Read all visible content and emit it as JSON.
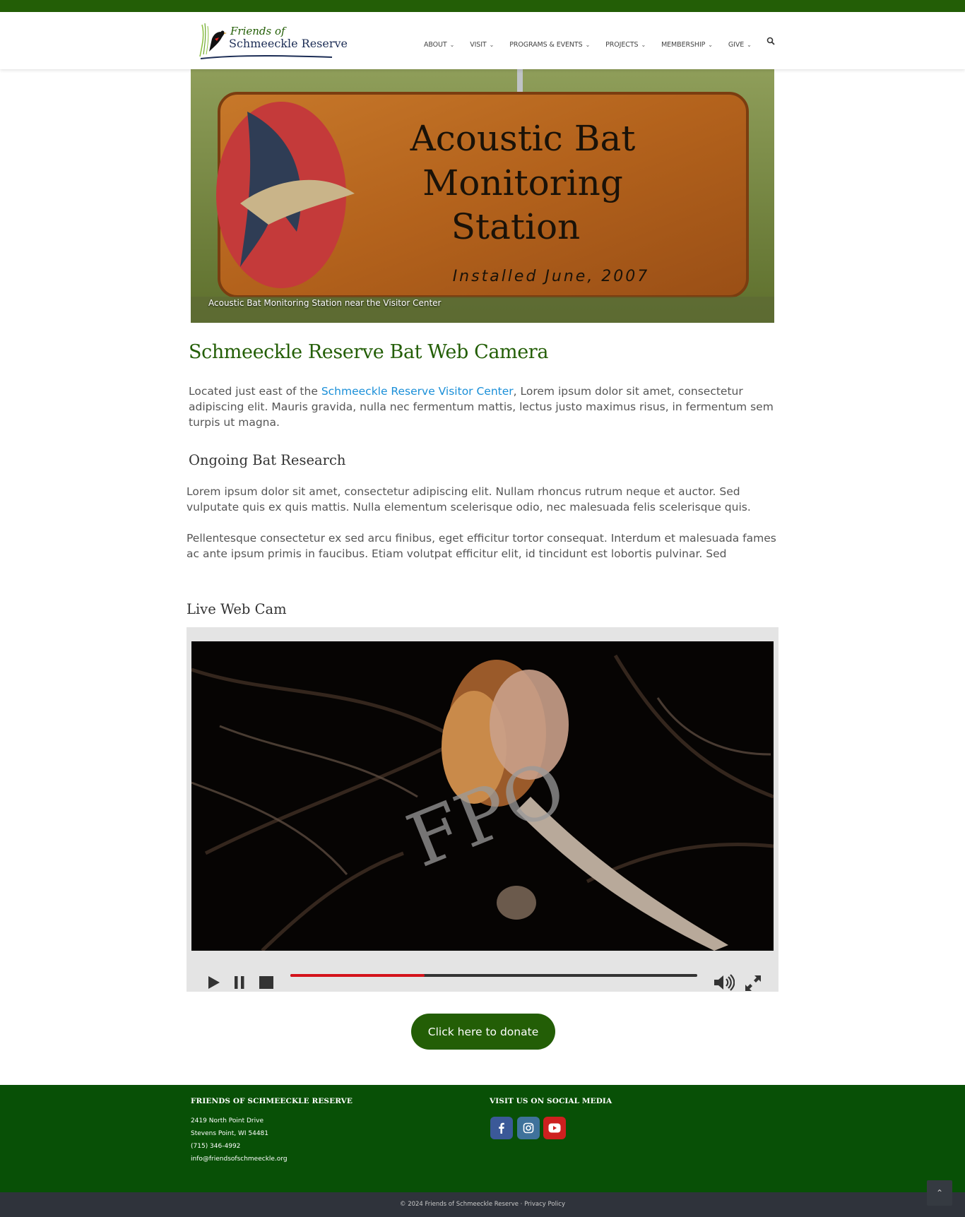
{
  "header": {
    "logo_line1": "Friends of",
    "logo_line2": "Schmeeckle Reserve"
  },
  "nav": {
    "items": [
      {
        "label": "ABOUT"
      },
      {
        "label": "VISIT"
      },
      {
        "label": "PROGRAMS & EVENTS"
      },
      {
        "label": "PROJECTS"
      },
      {
        "label": "MEMBERSHIP"
      },
      {
        "label": "GIVE"
      }
    ],
    "chevron": "⌄",
    "search_icon": "search-icon"
  },
  "hero": {
    "sign_line1": "Acoustic Bat",
    "sign_line2": "Monitoring",
    "sign_line3": "Station",
    "sign_line4": "Installed June, 2007",
    "caption": "Acoustic Bat Monitoring Station near the Visitor Center"
  },
  "main": {
    "title": "Schmeeckle Reserve Bat Web Camera",
    "intro_prefix": "Located just east of the ",
    "intro_link": "Schmeeckle Reserve Visitor Center",
    "intro_suffix": ", Lorem ipsum dolor sit amet, consectetur adipiscing elit. Mauris gravida, nulla nec fermentum mattis, lectus justo maximus risus, in fermentum sem turpis ut magna.",
    "research_heading": "Ongoing Bat Research",
    "research_p1": "Lorem ipsum dolor sit amet, consectetur adipiscing elit. Nullam rhoncus rutrum neque et auctor. Sed vulputate quis ex quis mattis. Nulla elementum scelerisque odio, nec malesuada felis scelerisque quis.",
    "research_p2": "Pellentesque consectetur ex sed arcu finibus, eget efficitur tortor consequat. Interdum et malesuada fames ac ante ipsum primis in faucibus. Etiam volutpat efficitur elit, id tincidunt est lobortis pulvinar. Sed",
    "webcam_heading": "Live Web Cam",
    "watermark": "FPO",
    "donate_label": "Click here to donate"
  },
  "player": {
    "progress": 0.33,
    "play_icon": "play-icon",
    "pause_icon": "pause-icon",
    "stop_icon": "stop-icon",
    "volume_icon": "volume-icon",
    "fullscreen_icon": "fullscreen-icon"
  },
  "footer": {
    "org_heading": "FRIENDS OF SCHMEECKLE RESERVE",
    "address_1": "2419 North Point Drive",
    "address_2": "Stevens Point, WI 54481",
    "phone": "(715) 346-4992",
    "email": "info@friendsofschmeeckle.org",
    "social_heading": "VISIT US ON SOCIAL MEDIA",
    "social": [
      "facebook-icon",
      "instagram-icon",
      "youtube-icon"
    ],
    "copyright": "© 2024 Friends of Schmeeckle Reserve",
    "separator": "·",
    "privacy": "Privacy Policy",
    "scroll_top": "⌃"
  },
  "colors": {
    "brand_green": "#235e06",
    "footer_green": "#085006",
    "link_blue": "#1a8fd8",
    "progress_red": "#d4121b"
  }
}
